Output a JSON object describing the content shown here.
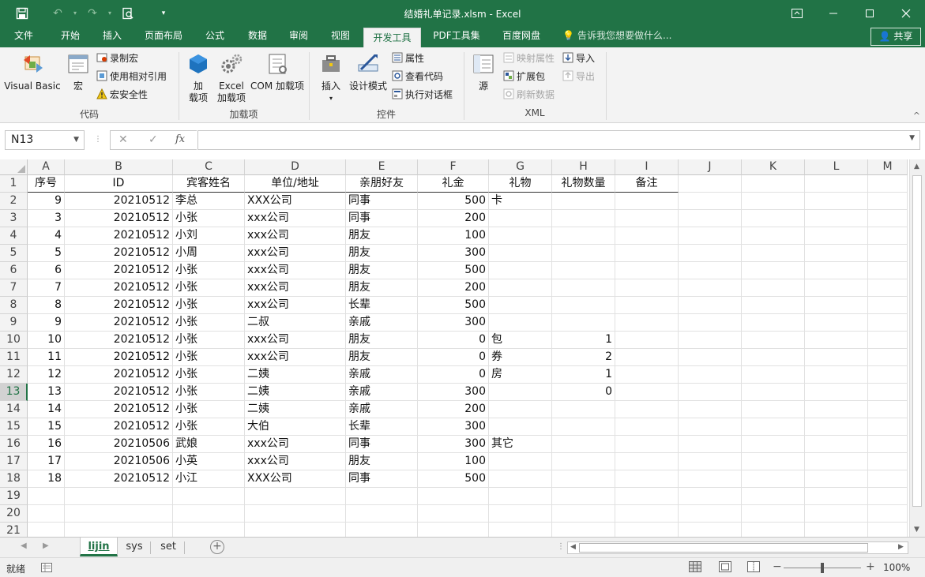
{
  "window": {
    "title": "结婚礼单记录.xlsm - Excel"
  },
  "ribbon_tabs": [
    {
      "label": "文件"
    },
    {
      "label": "开始"
    },
    {
      "label": "插入"
    },
    {
      "label": "页面布局"
    },
    {
      "label": "公式"
    },
    {
      "label": "数据"
    },
    {
      "label": "审阅"
    },
    {
      "label": "视图"
    },
    {
      "label": "开发工具",
      "active": true
    },
    {
      "label": "PDF工具集"
    },
    {
      "label": "百度网盘"
    }
  ],
  "tell_me": "告诉我您想要做什么...",
  "share": "共享",
  "ribbon": {
    "code": {
      "label": "代码",
      "visual_basic": "Visual Basic",
      "macros": "宏",
      "record_macro": "录制宏",
      "relative_ref": "使用相对引用",
      "macro_security": "宏安全性"
    },
    "addins": {
      "label": "加载项",
      "addins_line1": "加",
      "addins_line2": "载项",
      "excel_addins_line1": "Excel",
      "excel_addins_line2": "加载项",
      "com_addins": "COM 加载项"
    },
    "controls": {
      "label": "控件",
      "insert": "插入",
      "design_mode": "设计模式",
      "properties": "属性",
      "view_code": "查看代码",
      "run_dialog": "执行对话框"
    },
    "xml": {
      "label": "XML",
      "source": "源",
      "map_properties": "映射属性",
      "expansion_packs": "扩展包",
      "refresh_data": "刷新数据",
      "import": "导入",
      "export": "导出"
    }
  },
  "formula_bar": {
    "name_box": "N13",
    "fx": "fx",
    "formula": ""
  },
  "sheet": {
    "columns": [
      "A",
      "B",
      "C",
      "D",
      "E",
      "F",
      "G",
      "H",
      "I",
      "J",
      "K",
      "L",
      "M"
    ],
    "row_numbers": [
      "1",
      "2",
      "3",
      "4",
      "5",
      "6",
      "7",
      "8",
      "9",
      "10",
      "11",
      "12",
      "13",
      "14",
      "15",
      "16",
      "17",
      "18",
      "19",
      "20",
      "21"
    ],
    "selected_row": "13",
    "header": [
      "序号",
      "ID",
      "宾客姓名",
      "单位/地址",
      "亲朋好友",
      "礼金",
      "礼物",
      "礼物数量",
      "备注"
    ],
    "rows": [
      [
        "9",
        "20210512",
        "李总",
        "XXX公司",
        "同事",
        "500",
        "卡",
        "",
        ""
      ],
      [
        "3",
        "20210512",
        "小张",
        "xxx公司",
        "同事",
        "200",
        "",
        "",
        ""
      ],
      [
        "4",
        "20210512",
        "小刘",
        "xxx公司",
        "朋友",
        "100",
        "",
        "",
        ""
      ],
      [
        "5",
        "20210512",
        "小周",
        "xxx公司",
        "朋友",
        "300",
        "",
        "",
        ""
      ],
      [
        "6",
        "20210512",
        "小张",
        "xxx公司",
        "朋友",
        "500",
        "",
        "",
        ""
      ],
      [
        "7",
        "20210512",
        "小张",
        "xxx公司",
        "朋友",
        "200",
        "",
        "",
        ""
      ],
      [
        "8",
        "20210512",
        "小张",
        "xxx公司",
        "长辈",
        "500",
        "",
        "",
        ""
      ],
      [
        "9",
        "20210512",
        "小张",
        "二叔",
        "亲戚",
        "300",
        "",
        "",
        ""
      ],
      [
        "10",
        "20210512",
        "小张",
        "xxx公司",
        "朋友",
        "0",
        "包",
        "1",
        ""
      ],
      [
        "11",
        "20210512",
        "小张",
        "xxx公司",
        "朋友",
        "0",
        "券",
        "2",
        ""
      ],
      [
        "12",
        "20210512",
        "小张",
        "二姨",
        "亲戚",
        "0",
        "房",
        "1",
        ""
      ],
      [
        "13",
        "20210512",
        "小张",
        "二姨",
        "亲戚",
        "300",
        "",
        "0",
        ""
      ],
      [
        "14",
        "20210512",
        "小张",
        "二姨",
        "亲戚",
        "200",
        "",
        "",
        ""
      ],
      [
        "15",
        "20210512",
        "小张",
        "大伯",
        "长辈",
        "300",
        "",
        "",
        ""
      ],
      [
        "16",
        "20210506",
        "武娘",
        "xxx公司",
        "同事",
        "300",
        "其它",
        "",
        ""
      ],
      [
        "17",
        "20210506",
        "小英",
        "xxx公司",
        "朋友",
        "100",
        "",
        "",
        ""
      ],
      [
        "18",
        "20210512",
        "小江",
        "XXX公司",
        "同事",
        "500",
        "",
        "",
        ""
      ]
    ]
  },
  "sheet_tabs": [
    {
      "label": "lijin",
      "active": true
    },
    {
      "label": "sys"
    },
    {
      "label": "set"
    }
  ],
  "status": {
    "ready": "就绪",
    "zoom": "100%",
    "zoom_minus": "−",
    "zoom_plus": "+"
  },
  "colors": {
    "accent": "#217346"
  }
}
